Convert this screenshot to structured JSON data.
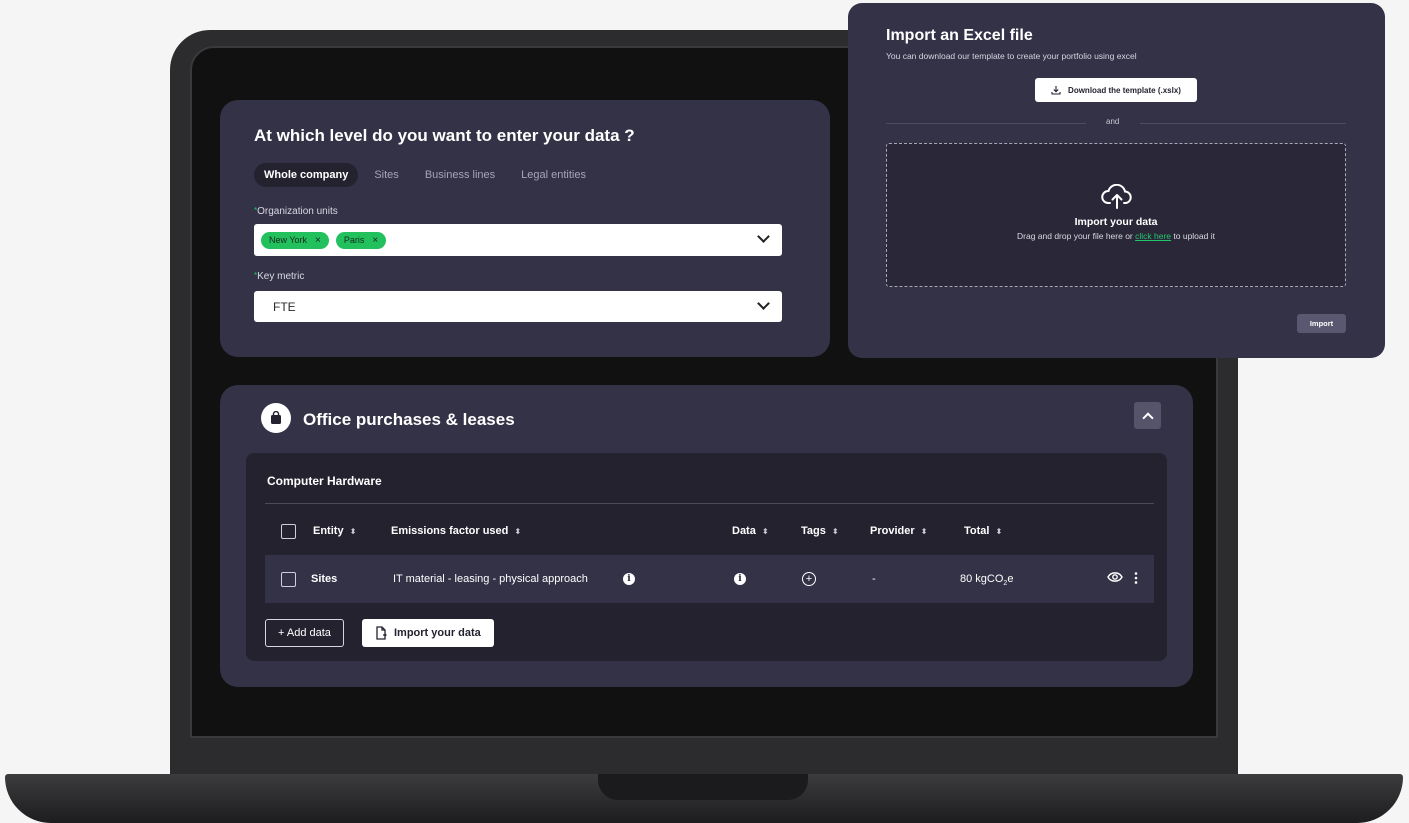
{
  "level_card": {
    "title": "At which level do you want to enter your data ?",
    "tabs": [
      {
        "label": "Whole company",
        "active": true
      },
      {
        "label": "Sites",
        "active": false
      },
      {
        "label": "Business lines",
        "active": false
      },
      {
        "label": "Legal entities",
        "active": false
      }
    ],
    "org_units": {
      "required_mark": "*",
      "label": "Organization units",
      "chips": [
        "New York",
        "Paris"
      ],
      "chip_remove": "×"
    },
    "key_metric": {
      "required_mark": "*",
      "label": "Key metric",
      "value": "FTE"
    }
  },
  "office_card": {
    "title": "Office purchases & leases",
    "icon": "shopping-bag-icon",
    "section": {
      "title": "Computer Hardware",
      "columns": [
        "Entity",
        "Emissions factor used",
        "Data",
        "Tags",
        "Provider",
        "Total"
      ],
      "sort_glyph": "⬍",
      "rows": [
        {
          "entity": "Sites",
          "emissions_factor": "IT material - leasing - physical approach",
          "provider": "-",
          "total_value": "80 kgCO",
          "total_sub": "2",
          "total_suffix": "e"
        }
      ]
    },
    "add_button": "+ Add data",
    "import_button": "Import your data"
  },
  "import_popup": {
    "title": "Import an Excel file",
    "subtitle": "You can download our template to create your portfolio using excel",
    "download_button": "Download the template (.xslx)",
    "separator": "and",
    "dropzone": {
      "title": "Import your data",
      "text_before": "Drag and drop your file here or ",
      "link": "click here",
      "text_after": " to upload it"
    },
    "import_button": "Import"
  },
  "colors": {
    "card_bg": "#343247",
    "inner_bg": "#24222f",
    "accent_green": "#22c15e"
  }
}
